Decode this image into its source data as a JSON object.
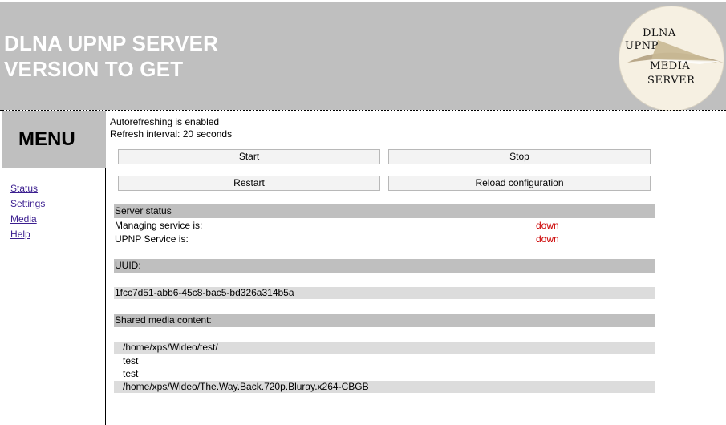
{
  "header": {
    "title": "DLNA UPNP SERVER\nVERSION TO GET",
    "logo_lines": [
      "DLNA",
      "UPNP",
      "MEDIA",
      "SERVER"
    ]
  },
  "sidebar": {
    "menu_title": "MENU",
    "items": [
      {
        "label": "Status"
      },
      {
        "label": "Settings"
      },
      {
        "label": "Media"
      },
      {
        "label": "Help"
      }
    ]
  },
  "main": {
    "autorefresh_text": "Autorefreshing is enabled",
    "refresh_interval_text": "Refresh interval: 20 seconds",
    "buttons": {
      "start": "Start",
      "stop": "Stop",
      "restart": "Restart",
      "reload": "Reload configuration"
    },
    "server_status": {
      "header": "Server status",
      "rows": [
        {
          "label": "Managing service is:",
          "value": "down"
        },
        {
          "label": "UPNP Service is:",
          "value": "down"
        }
      ]
    },
    "uuid": {
      "header": "UUID:",
      "value": "1fcc7d51-abb6-45c8-bac5-bd326a314b5a"
    },
    "shared_media": {
      "header": "Shared media content:",
      "entries": [
        "/home/xps/Wideo/test/",
        "test",
        "test",
        "/home/xps/Wideo/The.Way.Back.720p.Bluray.x264-CBGB"
      ]
    }
  },
  "colors": {
    "header_bg": "#bfbfbf",
    "status_down": "#cc0000",
    "link": "#3b1e8f",
    "light_bar": "#dcdcdc"
  }
}
